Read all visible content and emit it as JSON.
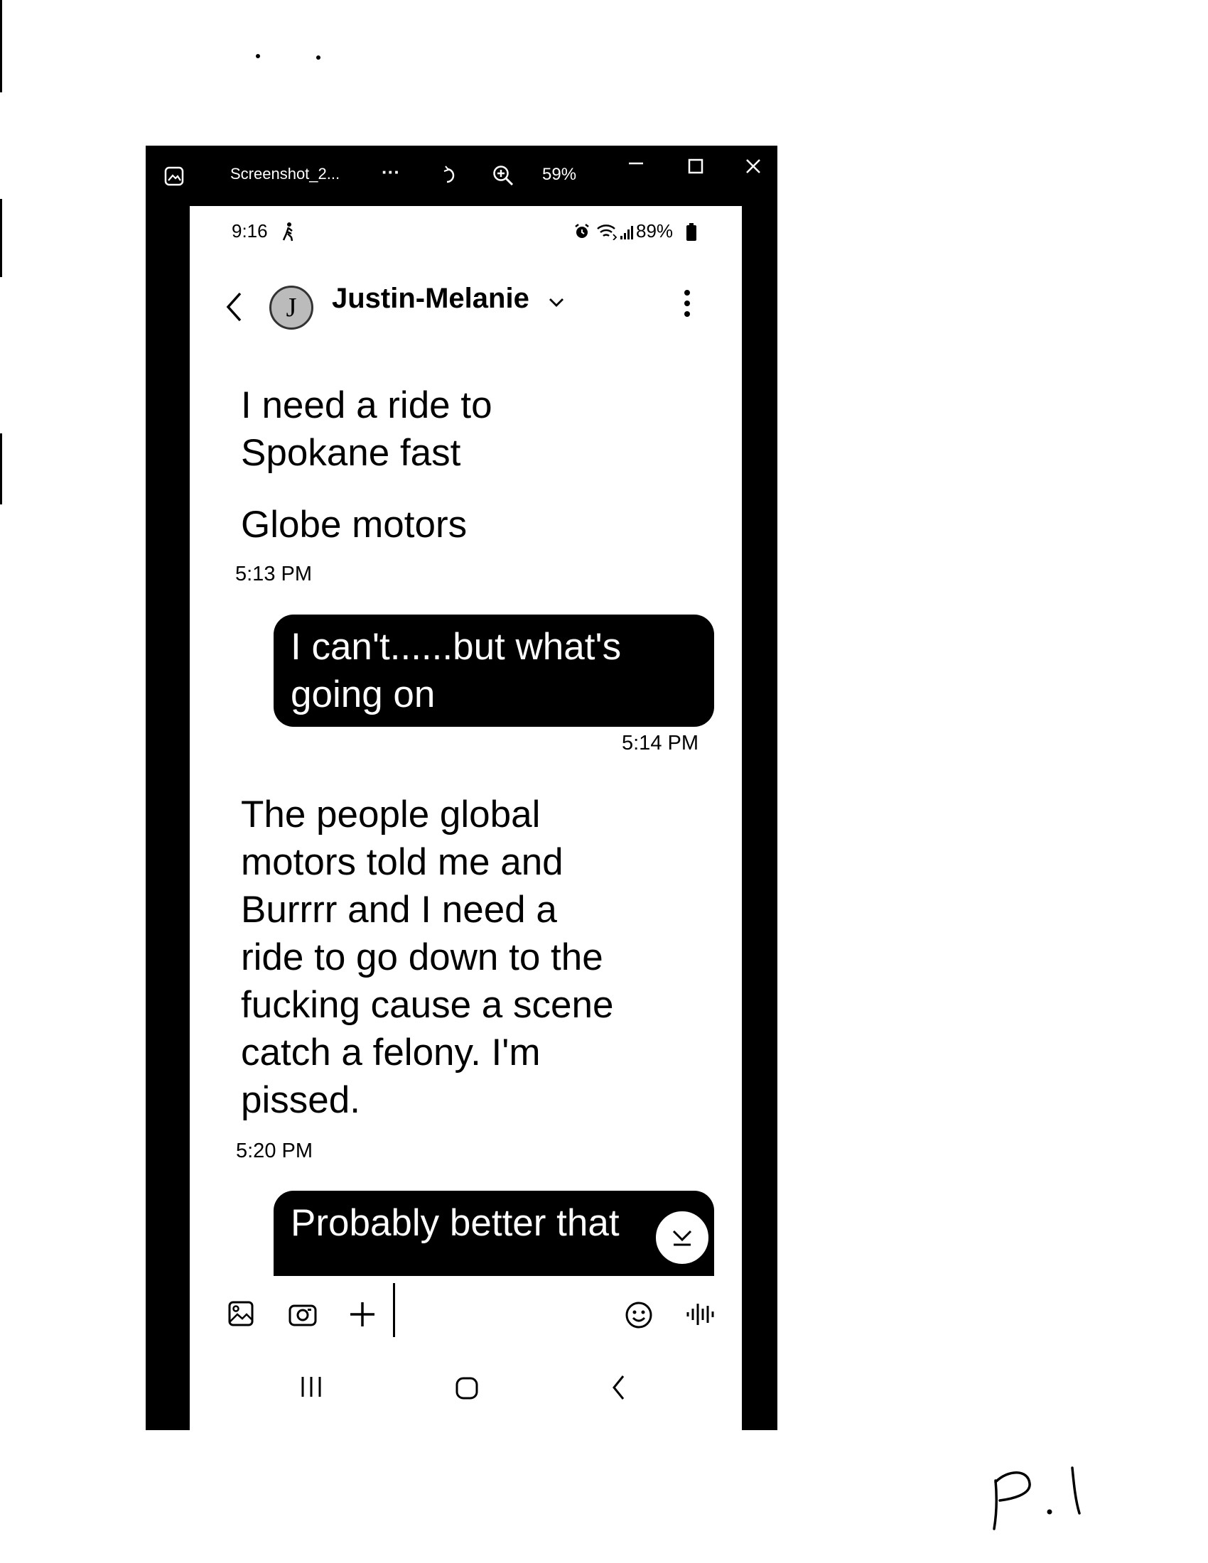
{
  "viewer": {
    "file_name": "Screenshot_2...",
    "more_label": "···",
    "zoom_level": "59%"
  },
  "status_bar": {
    "time": "9:16",
    "battery": "89%"
  },
  "conversation": {
    "contact_name": "Justin-Melanie",
    "avatar_initial": "J"
  },
  "messages": [
    {
      "direction": "in",
      "lines": [
        "I need a ride to",
        "Spokane fast"
      ]
    },
    {
      "direction": "in",
      "lines": [
        "Globe motors"
      ],
      "time": "5:13 PM"
    },
    {
      "direction": "out",
      "lines": [
        "I can't......but what's",
        "going on"
      ],
      "time": "5:14 PM"
    },
    {
      "direction": "in",
      "lines": [
        "The people global",
        "motors told me and",
        "Burrrr and I need a",
        "ride to go down to the",
        "fucking cause a scene",
        "catch a felony. I'm",
        "pissed."
      ],
      "time": "5:20 PM"
    },
    {
      "direction": "out",
      "lines": [
        "Probably better that"
      ]
    }
  ],
  "annotation": {
    "page_mark": "P. 1"
  },
  "icons": [
    "gallery-icon",
    "more-icon",
    "rotate-icon",
    "zoom-in-icon",
    "minimize-icon",
    "maximize-icon",
    "close-icon",
    "walk-icon",
    "alarm-icon",
    "wifi-icon",
    "signal-icon",
    "battery-icon",
    "back-icon",
    "chevron-down-icon",
    "kebab-menu-icon",
    "image-icon",
    "camera-icon",
    "plus-icon",
    "emoji-icon",
    "voice-icon",
    "recents-icon",
    "home-icon",
    "nav-back-icon",
    "scroll-down-icon"
  ]
}
